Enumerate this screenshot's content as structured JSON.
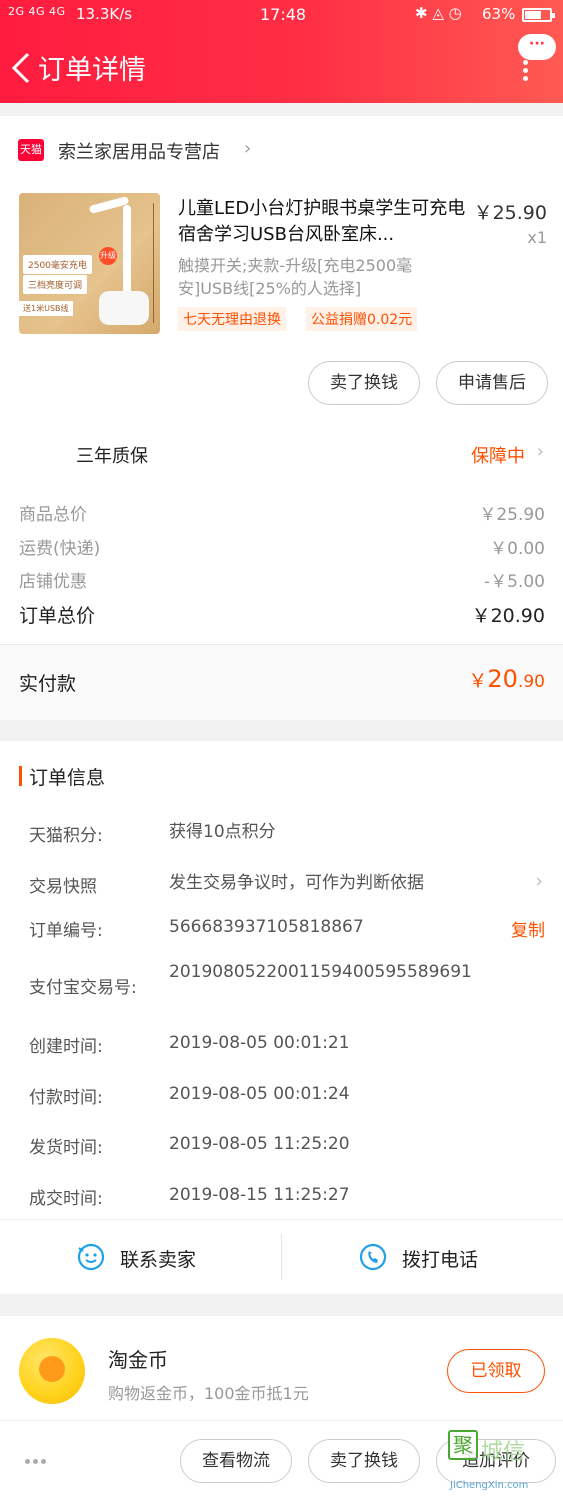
{
  "status_bar": {
    "signal": "2G 4G 4G",
    "net_speed": "13.3K/s",
    "time": "17:48",
    "battery": "63%",
    "battery_level": 0.63
  },
  "header": {
    "title": "订单详情",
    "more_label": "···"
  },
  "store": {
    "badge": "天猫",
    "name": "索兰家居用品专营店"
  },
  "product": {
    "title": "儿童LED小台灯护眼书桌学生可充电宿舍学习USB台风卧室床...",
    "price": "￥25.90",
    "qty": "x1",
    "sku": "触摸开关;夹款-升级[充电2500毫安]USB线[25%的人选择]",
    "tags": [
      "七天无理由退换",
      "公益捐赠0.02元"
    ],
    "thumb_text": {
      "battery": "2500毫安充电",
      "brightness": "三档亮度可调",
      "usb": "送1米USB线",
      "upgrade": "升级"
    }
  },
  "actions": {
    "sell": "卖了换钱",
    "after_sale": "申请售后"
  },
  "warranty": {
    "label": "三年质保",
    "status": "保障中"
  },
  "costs": [
    {
      "label": "商品总价",
      "value": "￥25.90"
    },
    {
      "label": "运费(快递)",
      "value": "￥0.00"
    },
    {
      "label": "店铺优惠",
      "value": "-￥5.00"
    }
  ],
  "total": {
    "label": "订单总价",
    "value": "￥20.90"
  },
  "paid": {
    "label": "实付款",
    "currency": "￥",
    "integer": "20",
    "decimal": ".90"
  },
  "order_info": {
    "title": "订单信息",
    "rows": [
      {
        "key": "天猫积分:",
        "value": "获得10点积分"
      },
      {
        "key": "交易快照",
        "value": "发生交易争议时，可作为判断依据"
      },
      {
        "key": "订单编号:",
        "value": "566683937105818867",
        "action": "复制"
      },
      {
        "key": "支付宝交易号:",
        "value": "2019080522001159400595589691"
      },
      {
        "key": "创建时间:",
        "value": "2019-08-05 00:01:21"
      },
      {
        "key": "付款时间:",
        "value": "2019-08-05 00:01:24"
      },
      {
        "key": "发货时间:",
        "value": "2019-08-05 11:25:20"
      },
      {
        "key": "成交时间:",
        "value": "2019-08-15 11:25:27"
      }
    ]
  },
  "contact": {
    "seller": "联系卖家",
    "phone": "拨打电话"
  },
  "coin": {
    "title": "淘金币",
    "subtitle": "购物返金币，100金币抵1元",
    "button": "已领取"
  },
  "bottom_bar": {
    "logistics": "查看物流",
    "sell": "卖了换钱",
    "review": "追加评价"
  },
  "watermark": {
    "char": "聚",
    "text": "城信",
    "url": "JiChengXin.com"
  },
  "colors": {
    "header_red": "#ff2f45",
    "accent_orange": "#ff5000",
    "coin_gold": "#ffd21a",
    "tmall_red": "#ff0036"
  }
}
